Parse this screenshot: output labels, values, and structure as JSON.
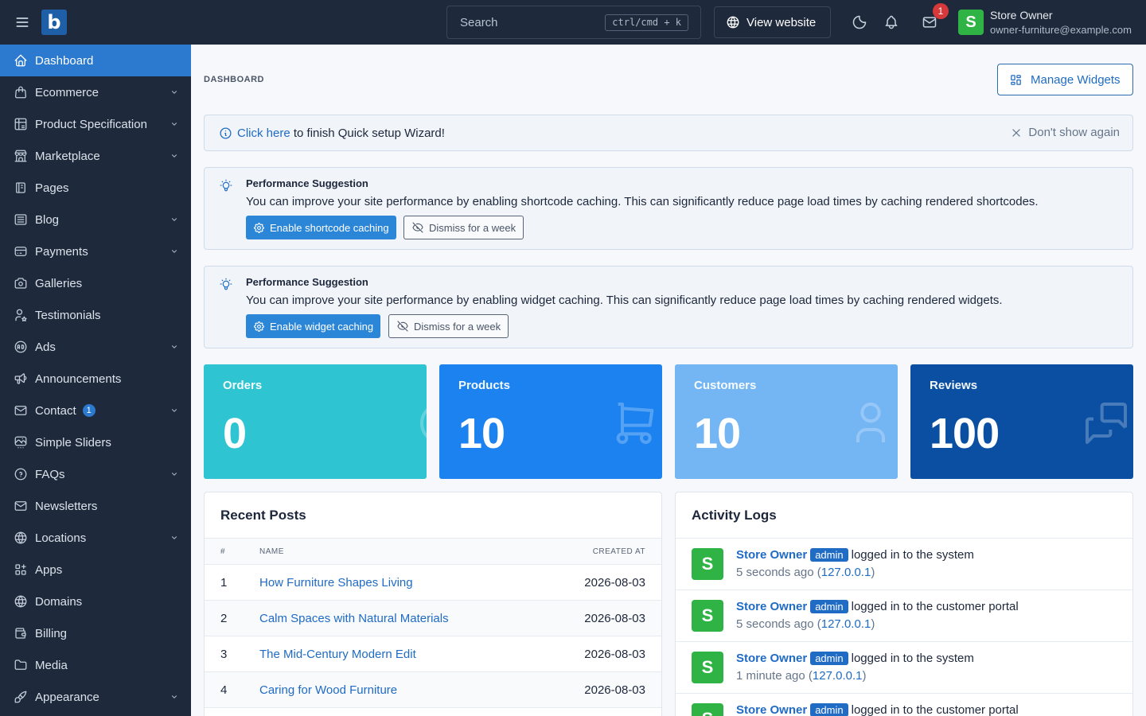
{
  "topbar": {
    "logo_letter": "b",
    "search_placeholder": "Search",
    "search_shortcut": "ctrl/cmd + k",
    "view_website_label": "View website",
    "mail_badge_count": "1",
    "user": {
      "avatar_letter": "S",
      "name": "Store Owner",
      "email": "owner-furniture@example.com"
    }
  },
  "sidebar": {
    "items": [
      {
        "label": "Dashboard",
        "icon": "home-icon",
        "active": true,
        "has_children": false
      },
      {
        "label": "Ecommerce",
        "icon": "shopping-bag-icon",
        "has_children": true
      },
      {
        "label": "Product Specification",
        "icon": "table-options-icon",
        "has_children": true
      },
      {
        "label": "Marketplace",
        "icon": "building-store-icon",
        "has_children": true
      },
      {
        "label": "Pages",
        "icon": "notebook-icon",
        "has_children": false
      },
      {
        "label": "Blog",
        "icon": "article-icon",
        "has_children": true
      },
      {
        "label": "Payments",
        "icon": "credit-card-icon",
        "has_children": true
      },
      {
        "label": "Galleries",
        "icon": "camera-icon",
        "has_children": false
      },
      {
        "label": "Testimonials",
        "icon": "user-star-icon",
        "has_children": false
      },
      {
        "label": "Ads",
        "icon": "ad-circle-icon",
        "has_children": true
      },
      {
        "label": "Announcements",
        "icon": "speakerphone-icon",
        "has_children": false
      },
      {
        "label": "Contact",
        "icon": "mail-icon",
        "has_children": true,
        "badge": "1"
      },
      {
        "label": "Simple Sliders",
        "icon": "slideshow-icon",
        "has_children": false
      },
      {
        "label": "FAQs",
        "icon": "help-circle-icon",
        "has_children": true
      },
      {
        "label": "Newsletters",
        "icon": "mail-icon",
        "has_children": false
      },
      {
        "label": "Locations",
        "icon": "world-icon",
        "has_children": true
      },
      {
        "label": "Apps",
        "icon": "apps-plus-icon",
        "has_children": false
      },
      {
        "label": "Domains",
        "icon": "world-icon",
        "has_children": false
      },
      {
        "label": "Billing",
        "icon": "wallet-icon",
        "has_children": false
      },
      {
        "label": "Media",
        "icon": "folder-icon",
        "has_children": false
      },
      {
        "label": "Appearance",
        "icon": "brush-icon",
        "has_children": true
      }
    ]
  },
  "main": {
    "breadcrumb": "DASHBOARD",
    "manage_widgets_label": "Manage Widgets",
    "wizard": {
      "link_text": "Click here",
      "text": " to finish Quick setup Wizard!",
      "dismiss_label": "Don't show again"
    },
    "suggestions": [
      {
        "title": "Performance Suggestion",
        "text": "You can improve your site performance by enabling shortcode caching. This can significantly reduce page load times by caching rendered shortcodes.",
        "primary_label": "Enable shortcode caching",
        "dismiss_label": "Dismiss for a week"
      },
      {
        "title": "Performance Suggestion",
        "text": "You can improve your site performance by enabling widget caching. This can significantly reduce page load times by caching rendered widgets.",
        "primary_label": "Enable widget caching",
        "dismiss_label": "Dismiss for a week"
      }
    ],
    "stats": [
      {
        "label": "Orders",
        "value": "0",
        "color": "#2ec4d1",
        "icon": "coin-icon"
      },
      {
        "label": "Products",
        "value": "10",
        "color": "#1c82ef",
        "icon": "shopping-cart-icon"
      },
      {
        "label": "Customers",
        "value": "10",
        "color": "#74b5f4",
        "icon": "user-icon"
      },
      {
        "label": "Reviews",
        "value": "100",
        "color": "#0b4fa3",
        "icon": "messages-icon"
      }
    ],
    "recent_posts": {
      "title": "Recent Posts",
      "columns": [
        "#",
        "NAME",
        "CREATED AT"
      ],
      "rows": [
        {
          "num": "1",
          "name": "How Furniture Shapes Living",
          "date": "2026-08-03"
        },
        {
          "num": "2",
          "name": "Calm Spaces with Natural Materials",
          "date": "2026-08-03"
        },
        {
          "num": "3",
          "name": "The Mid-Century Modern Edit",
          "date": "2026-08-03"
        },
        {
          "num": "4",
          "name": "Caring for Wood Furniture",
          "date": "2026-08-03"
        }
      ]
    },
    "activity_logs": {
      "title": "Activity Logs",
      "entries": [
        {
          "avatar": "S",
          "user": "Store Owner",
          "role": "admin",
          "action": "logged in to the system",
          "time": "5 seconds ago",
          "ip": "127.0.0.1"
        },
        {
          "avatar": "S",
          "user": "Store Owner",
          "role": "admin",
          "action": "logged in to the customer portal",
          "time": "5 seconds ago",
          "ip": "127.0.0.1"
        },
        {
          "avatar": "S",
          "user": "Store Owner",
          "role": "admin",
          "action": "logged in to the system",
          "time": "1 minute ago",
          "ip": "127.0.0.1"
        },
        {
          "avatar": "S",
          "user": "Store Owner",
          "role": "admin",
          "action": "logged in to the customer portal",
          "time": "",
          "ip": ""
        }
      ]
    }
  }
}
